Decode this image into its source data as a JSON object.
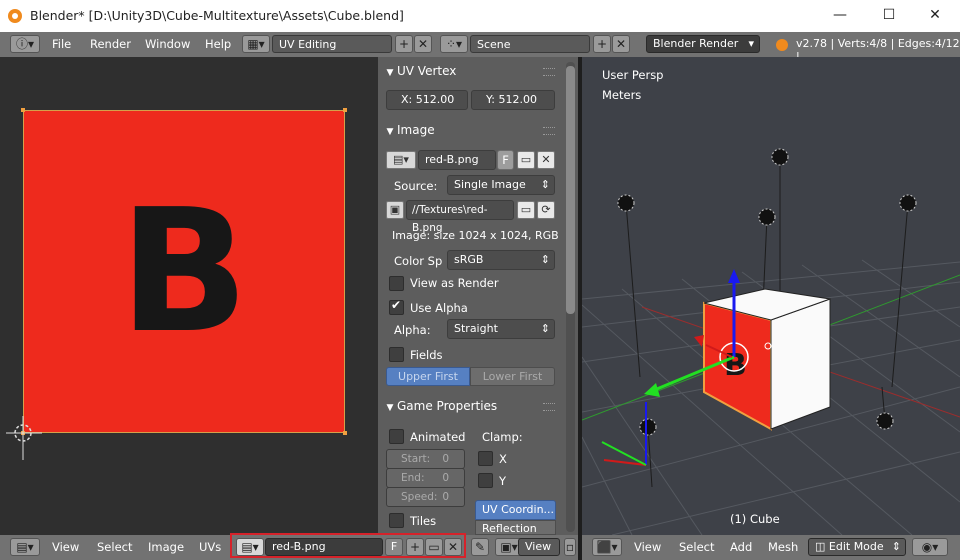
{
  "window": {
    "title": "Blender* [D:\\Unity3D\\Cube-Multitexture\\Assets\\Cube.blend]",
    "minimize": "—",
    "maximize": "☐",
    "close": "✕"
  },
  "top_menu": [
    "File",
    "Render",
    "Window",
    "Help"
  ],
  "screen_layout": "UV Editing",
  "scene": "Scene",
  "render_engine": "Blender Render",
  "stats": "v2.78 | Verts:4/8 | Edges:4/12 |",
  "uv_vertex": {
    "header": "UV Vertex",
    "x": "X: 512.00",
    "y": "Y: 512.00"
  },
  "image_panel": {
    "header": "Image",
    "image_name": "red-B.png",
    "fake_user": "F",
    "source_label": "Source:",
    "source_value": "Single Image",
    "filepath": "//Textures\\red-B.png",
    "info": "Image: size 1024 x 1024, RGB",
    "color_space_label": "Color Sp",
    "color_space_value": "sRGB",
    "view_as_render": "View as Render",
    "use_alpha": "Use Alpha",
    "alpha_label": "Alpha:",
    "alpha_value": "Straight",
    "fields": "Fields",
    "upper_first": "Upper First",
    "lower_first": "Lower First"
  },
  "game_properties": {
    "header": "Game Properties",
    "animated": "Animated",
    "clamp": "Clamp:",
    "start": "Start:",
    "start_val": "0",
    "end": "End:",
    "end_val": "0",
    "speed": "Speed:",
    "speed_val": "0",
    "clamp_x": "X",
    "clamp_y": "Y",
    "uv_coord": "UV Coordin...",
    "reflection": "Reflection",
    "tiles": "Tiles"
  },
  "uv_image_letter": "B",
  "viewport": {
    "view_label": "User Persp",
    "units": "Meters",
    "object_label": "(1) Cube"
  },
  "uv_footer": {
    "menus": [
      "View",
      "Select",
      "Image",
      "UVs"
    ],
    "image_name": "red-B.png",
    "fake_user": "F",
    "view_select": "View"
  },
  "view3d_footer": {
    "menus": [
      "View",
      "Select",
      "Add",
      "Mesh"
    ],
    "mode": "Edit Mode"
  },
  "colors": {
    "uv_image": "#ee2a1d",
    "highlight_box": "#d6222a",
    "active_button": "#5680c2"
  }
}
